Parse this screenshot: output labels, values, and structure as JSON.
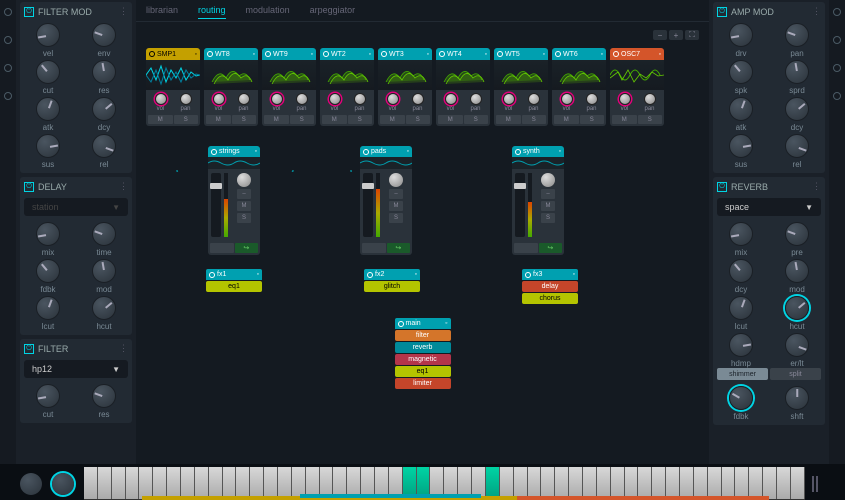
{
  "left_panels": [
    {
      "title": "FILTER MOD",
      "knobs": [
        "vel",
        "env",
        "cut",
        "res",
        "atk",
        "dcy",
        "sus",
        "rel"
      ]
    },
    {
      "title": "DELAY",
      "dropdown": "station",
      "dim": true,
      "knobs": [
        "mix",
        "time",
        "fdbk",
        "mod",
        "lcut",
        "hcut"
      ]
    },
    {
      "title": "FILTER",
      "dropdown": "hp12",
      "knobs": [
        "cut",
        "res"
      ]
    }
  ],
  "right_panels": [
    {
      "title": "AMP MOD",
      "knobs": [
        "drv",
        "pan",
        "spk",
        "sprd",
        "atk",
        "dcy",
        "sus",
        "rel"
      ]
    },
    {
      "title": "REVERB",
      "dropdown": "space",
      "knobs": [
        "mix",
        "pre",
        "dcy",
        "mod",
        "lcut",
        "hcut",
        "hdmp",
        "er/lt"
      ],
      "active_knobs": [
        "hcut"
      ],
      "buttons": [
        "shimmer",
        "split"
      ],
      "extra_knobs": [
        "fdbk",
        "shft"
      ]
    }
  ],
  "tabs": [
    "librarian",
    "routing",
    "modulation",
    "arpeggiator"
  ],
  "active_tab": "routing",
  "oscillators": [
    {
      "name": "SMP1",
      "color": "yellow",
      "wave": "sample"
    },
    {
      "name": "WT8",
      "color": "teal",
      "wave": "3d"
    },
    {
      "name": "WT9",
      "color": "teal",
      "wave": "3d"
    },
    {
      "name": "WT2",
      "color": "teal",
      "wave": "3d"
    },
    {
      "name": "WT3",
      "color": "teal",
      "wave": "3d"
    },
    {
      "name": "WT4",
      "color": "teal",
      "wave": "3d"
    },
    {
      "name": "WT5",
      "color": "teal",
      "wave": "3d"
    },
    {
      "name": "WT6",
      "color": "teal",
      "wave": "3d"
    },
    {
      "name": "OSC7",
      "color": "orange",
      "wave": "analog"
    }
  ],
  "osc_knob_labels": [
    "vol",
    "pan"
  ],
  "osc_btn_labels": [
    "M",
    "S"
  ],
  "mixers": [
    {
      "name": "strings",
      "meter": 60
    },
    {
      "name": "pads",
      "meter": 75
    },
    {
      "name": "synth",
      "meter": 55
    }
  ],
  "mixer_btns": [
    "–",
    "M",
    "S"
  ],
  "fx_nodes": [
    {
      "name": "fx1",
      "slots": [
        {
          "label": "eq1",
          "color": "yellow"
        }
      ]
    },
    {
      "name": "fx2",
      "slots": [
        {
          "label": "glitch",
          "color": "yellow"
        }
      ]
    },
    {
      "name": "fx3",
      "slots": [
        {
          "label": "delay",
          "color": "red"
        },
        {
          "label": "chorus",
          "color": "yellow"
        }
      ]
    }
  ],
  "main_node": {
    "name": "main",
    "slots": [
      {
        "label": "filter",
        "color": "orange"
      },
      {
        "label": "reverb",
        "color": "blue"
      },
      {
        "label": "magnetic",
        "color": "magenta"
      },
      {
        "label": "eq1",
        "color": "yellow"
      },
      {
        "label": "limiter",
        "color": "red"
      }
    ]
  },
  "hot_keys": [
    23,
    24,
    29
  ]
}
